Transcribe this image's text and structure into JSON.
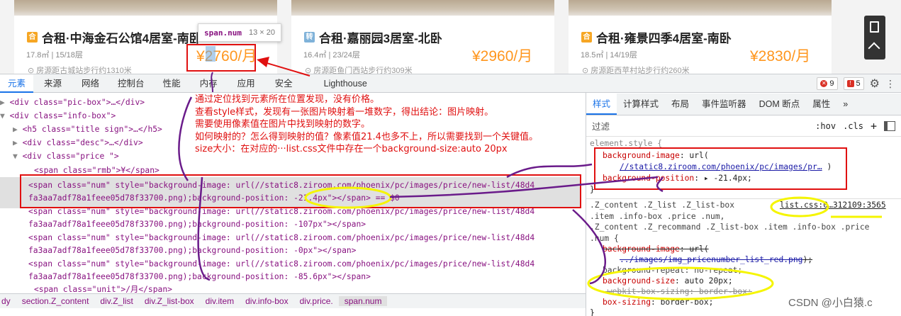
{
  "listings": [
    {
      "tag": "合",
      "tag_color": "#f6a623",
      "title": "合租·中海金石公馆4居室-南卧",
      "desc": "17.8㎡ | 15/18层",
      "price": "¥2760/月",
      "location": "房源距古城站步行约1310米"
    },
    {
      "tag": "转",
      "tag_color": "#7fb2d9",
      "title": "合租·嘉丽园3居室-北卧",
      "desc": "16.4㎡ | 23/24层",
      "price": "¥2960/月",
      "location": "房源距鱼门西站步行约309米"
    },
    {
      "tag": "合",
      "tag_color": "#f6a623",
      "title": "合租·雍景四季4居室-南卧",
      "desc": "18.5㎡ | 14/19层",
      "price": "¥2830/月",
      "location": "房源距西苹村站步行约260米"
    }
  ],
  "tooltip": {
    "selector": "span.num",
    "size": "13 × 20"
  },
  "devtools": {
    "tabs": [
      "元素",
      "来源",
      "网络",
      "控制台",
      "性能",
      "内存",
      "应用",
      "安全",
      "Lighthouse"
    ],
    "active_tab": "元素",
    "error_count": "9",
    "warning_count": "5"
  },
  "dom_lines": [
    {
      "indent": "",
      "arrow": "▶",
      "text": "<div class=\"pic-box\">…</div>"
    },
    {
      "indent": "",
      "arrow": "▼",
      "text": "<div class=\"info-box\">"
    },
    {
      "indent": "  ",
      "arrow": "▶",
      "text": "<h5 class=\"title sign\">…</h5>"
    },
    {
      "indent": "  ",
      "arrow": "▶",
      "text": "<div class=\"desc\">…</div>"
    },
    {
      "indent": "  ",
      "arrow": "▼",
      "text": "<div class=\"price \">"
    },
    {
      "indent": "      ",
      "arrow": "",
      "text": "<span class=\"rmb\">¥</span>"
    }
  ],
  "spans": [
    {
      "l1": "<span class=\"num\" style=\"background-image: url(//static8.ziroom.com/phoenix/pc/images/price/new-list/48d4",
      "l2": "fa3aa7adf78a1feee05d78f33700.png);background-position: -21.4px\"></span> == $0"
    },
    {
      "l1": "<span class=\"num\" style=\"background-image: url(//static8.ziroom.com/phoenix/pc/images/price/new-list/48d4",
      "l2": "fa3aa7adf78a1feee05d78f33700.png);background-position: -107px\"></span>"
    },
    {
      "l1": "<span class=\"num\" style=\"background-image: url(//static8.ziroom.com/phoenix/pc/images/price/new-list/48d4",
      "l2": "fa3aa7adf78a1feee05d78f33700.png);background-position: -0px\"></span>"
    },
    {
      "l1": "<span class=\"num\" style=\"background-image: url(//static8.ziroom.com/phoenix/pc/images/price/new-list/48d4",
      "l2": "fa3aa7adf78a1feee05d78f33700.png);background-position: -85.6px\"></span>"
    }
  ],
  "last_line": "<span class=\"unit\">/月</span>",
  "breadcrumbs": [
    "dy",
    "section.Z_content",
    "div.Z_list",
    "div.Z_list-box",
    "div.item",
    "div.info-box",
    "div.price.",
    "span.num"
  ],
  "side_tabs": [
    "样式",
    "计算样式",
    "布局",
    "事件监听器",
    "DOM 断点",
    "属性",
    "»"
  ],
  "filter": {
    "placeholder": "过滤",
    "hov": ":hov",
    "cls": ".cls",
    "plus": "+"
  },
  "styles": {
    "element_style_header": "element.style {",
    "bg_image_prop": "background-image",
    "bg_image_url": "//static8.ziroom.com/phoenix/pc/images/pr…",
    "bg_pos_prop": "background-position",
    "bg_pos_val": "-21.4px;",
    "close": "}",
    "rule_selector": ".Z_content .Z_list .Z_list-box\n.item .info-box .price .num,\n.Z_content .Z_recommand .Z_list-box .item .info-box .price\n.num {",
    "rule_source": "list.css:0…312109:3565",
    "r_bg_image_prop": "background-image",
    "r_bg_image_url": "../images/img_pricenumber_list_red.png",
    "r_bg_repeat": "background-repeat: no-repeat;",
    "r_bg_size_prop": "background-size",
    "r_bg_size_val": "auto 20px;",
    "r_box_sizing_strike": "-webkit-box-sizing: border-box;",
    "r_box_sizing_prop": "box-sizing",
    "r_box_sizing_val": "border-box;"
  },
  "annotation_lines": [
    "通过定位找到元素所在位置发现，没有价格。",
    "查看style样式，发现有一张图片映射着一堆数字，得出结论：图片映射。",
    "需要使用像素值在图片中找到映射的数字。",
    "如何映射的？怎么得到映射的值？像素值21.4也多不上，所以需要找到一个关键值。",
    "size大小：在对应的···list.css文件中存在一个background-size:auto 20px"
  ],
  "watermark": "CSDN @小白猿.c",
  "colors": {
    "price_orange": "#ff961e",
    "annotation_red": "#e01010",
    "highlight_yellow": "#f5f500",
    "arrow_purple": "#6a1b8a",
    "devtools_blue": "#1a73e8"
  }
}
